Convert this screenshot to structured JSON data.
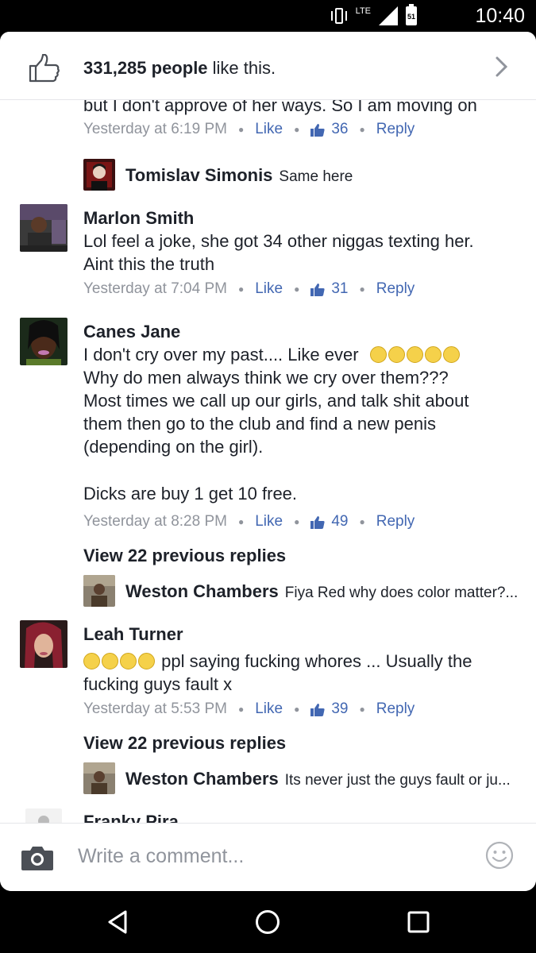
{
  "status_bar": {
    "network": "LTE",
    "battery": "51",
    "time": "10:40"
  },
  "likes_bar": {
    "count": "331,285 people",
    "suffix": " like this."
  },
  "comments": [
    {
      "text_lines": [
        "but I don't approve of her ways. So I am moving on"
      ],
      "time": "Yesterday at 6:19 PM",
      "like_label": "Like",
      "like_count": "36",
      "reply_label": "Reply",
      "reply_preview": {
        "name": "Tomislav Simonis",
        "text": "Same here"
      }
    },
    {
      "name": "Marlon Smith",
      "text_lines": [
        "Lol feel a joke, she got 34 other niggas texting her.",
        "Aint this the truth"
      ],
      "time": "Yesterday at 7:04 PM",
      "like_label": "Like",
      "like_count": "31",
      "reply_label": "Reply"
    },
    {
      "name": "Canes Jane",
      "text_lines": [
        "I don't cry over my past.... Like ever",
        "Why do men always think we cry over them???",
        "Most times we call up our girls, and talk shit about",
        "them then go to the club and find a new penis",
        "(depending on the girl).",
        "",
        "Dicks are buy 1 get 10 free."
      ],
      "time": "Yesterday at 8:28 PM",
      "like_label": "Like",
      "like_count": "49",
      "reply_label": "Reply",
      "view_previous": "View 22 previous replies",
      "reply_preview": {
        "name": "Weston Chambers",
        "text": "Fiya Red why does color matter?..."
      }
    },
    {
      "name": "Leah Turner",
      "text_lines": [
        "ppl saying fucking whores ... Usually the",
        "fucking guys fault x"
      ],
      "time": "Yesterday at 5:53 PM",
      "like_label": "Like",
      "like_count": "39",
      "reply_label": "Reply",
      "view_previous": "View 22 previous replies",
      "reply_preview": {
        "name": "Weston Chambers",
        "text": "Its never just the guys fault or ju..."
      }
    },
    {
      "name": "Franky Pira"
    }
  ],
  "composer": {
    "placeholder": "Write a comment..."
  },
  "colors": {
    "link": "#4267b2",
    "meta": "#90949c",
    "text": "#1d2129"
  },
  "icons": [
    "vibrate-icon",
    "signal-icon",
    "battery-icon",
    "thumbs-up-icon",
    "chevron-right-icon",
    "camera-icon",
    "smiley-icon",
    "back-icon",
    "home-icon",
    "recents-icon"
  ]
}
